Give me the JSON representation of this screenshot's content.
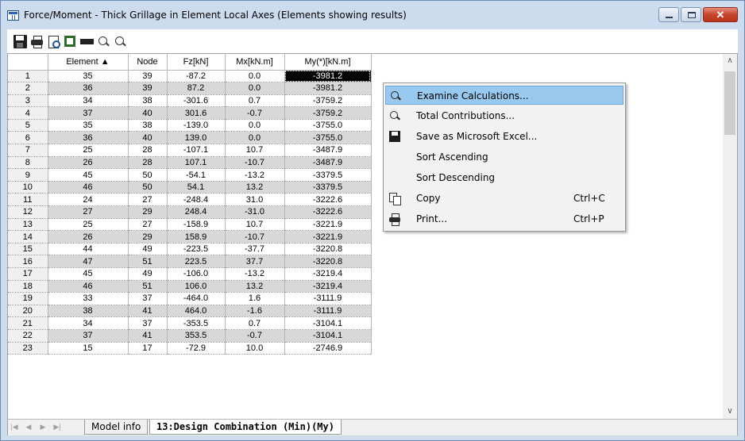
{
  "window": {
    "title": "Force/Moment - Thick Grillage in Element Local Axes (Elements showing results)"
  },
  "toolbar": {
    "icons": [
      "save-icon",
      "print-icon",
      "print-preview-icon",
      "export-excel-icon",
      "ruler-icon",
      "zoom-in-icon",
      "zoom-out-icon"
    ]
  },
  "grid": {
    "columns": [
      "Element ▲",
      "Node",
      "Fz[kN]",
      "Mx[kN.m]",
      "My(*)[kN.m]"
    ],
    "rows": [
      [
        "1",
        "35",
        "39",
        "-87.2",
        "0.0",
        "-3981.2"
      ],
      [
        "2",
        "36",
        "39",
        "87.2",
        "0.0",
        "-3981.2"
      ],
      [
        "3",
        "34",
        "38",
        "-301.6",
        "0.7",
        "-3759.2"
      ],
      [
        "4",
        "37",
        "40",
        "301.6",
        "-0.7",
        "-3759.2"
      ],
      [
        "5",
        "35",
        "38",
        "-139.0",
        "0.0",
        "-3755.0"
      ],
      [
        "6",
        "36",
        "40",
        "139.0",
        "0.0",
        "-3755.0"
      ],
      [
        "7",
        "25",
        "28",
        "-107.1",
        "10.7",
        "-3487.9"
      ],
      [
        "8",
        "26",
        "28",
        "107.1",
        "-10.7",
        "-3487.9"
      ],
      [
        "9",
        "45",
        "50",
        "-54.1",
        "-13.2",
        "-3379.5"
      ],
      [
        "10",
        "46",
        "50",
        "54.1",
        "13.2",
        "-3379.5"
      ],
      [
        "11",
        "24",
        "27",
        "-248.4",
        "31.0",
        "-3222.6"
      ],
      [
        "12",
        "27",
        "29",
        "248.4",
        "-31.0",
        "-3222.6"
      ],
      [
        "13",
        "25",
        "27",
        "-158.9",
        "10.7",
        "-3221.9"
      ],
      [
        "14",
        "26",
        "29",
        "158.9",
        "-10.7",
        "-3221.9"
      ],
      [
        "15",
        "44",
        "49",
        "-223.5",
        "-37.7",
        "-3220.8"
      ],
      [
        "16",
        "47",
        "51",
        "223.5",
        "37.7",
        "-3220.8"
      ],
      [
        "17",
        "45",
        "49",
        "-106.0",
        "-13.2",
        "-3219.4"
      ],
      [
        "18",
        "46",
        "51",
        "106.0",
        "13.2",
        "-3219.4"
      ],
      [
        "19",
        "33",
        "37",
        "-464.0",
        "1.6",
        "-3111.9"
      ],
      [
        "20",
        "38",
        "41",
        "464.0",
        "-1.6",
        "-3111.9"
      ],
      [
        "21",
        "34",
        "37",
        "-353.5",
        "0.7",
        "-3104.1"
      ],
      [
        "22",
        "37",
        "41",
        "353.5",
        "-0.7",
        "-3104.1"
      ],
      [
        "23",
        "15",
        "17",
        "-72.9",
        "10.0",
        "-2746.9"
      ]
    ],
    "selected_cell": "-3981.2"
  },
  "tabs": {
    "items": [
      "Model info",
      "13:Design Combination (Min)(My)"
    ],
    "active": "13:Design Combination (Min)(My)"
  },
  "context_menu": {
    "items": [
      {
        "label": "Examine Calculations...",
        "shortcut": "",
        "icon": "examine-icon",
        "highlighted": true
      },
      {
        "label": "Total Contributions...",
        "shortcut": "",
        "icon": "magnifier-icon",
        "highlighted": false
      },
      {
        "label": "Save as Microsoft Excel...",
        "shortcut": "",
        "icon": "save-icon",
        "highlighted": false
      },
      {
        "label": "Sort Ascending",
        "shortcut": "",
        "icon": "",
        "highlighted": false
      },
      {
        "label": "Sort Descending",
        "shortcut": "",
        "icon": "",
        "highlighted": false
      },
      {
        "label": "Copy",
        "shortcut": "Ctrl+C",
        "icon": "copy-icon",
        "highlighted": false
      },
      {
        "label": "Print...",
        "shortcut": "Ctrl+P",
        "icon": "print-icon",
        "highlighted": false
      }
    ]
  }
}
